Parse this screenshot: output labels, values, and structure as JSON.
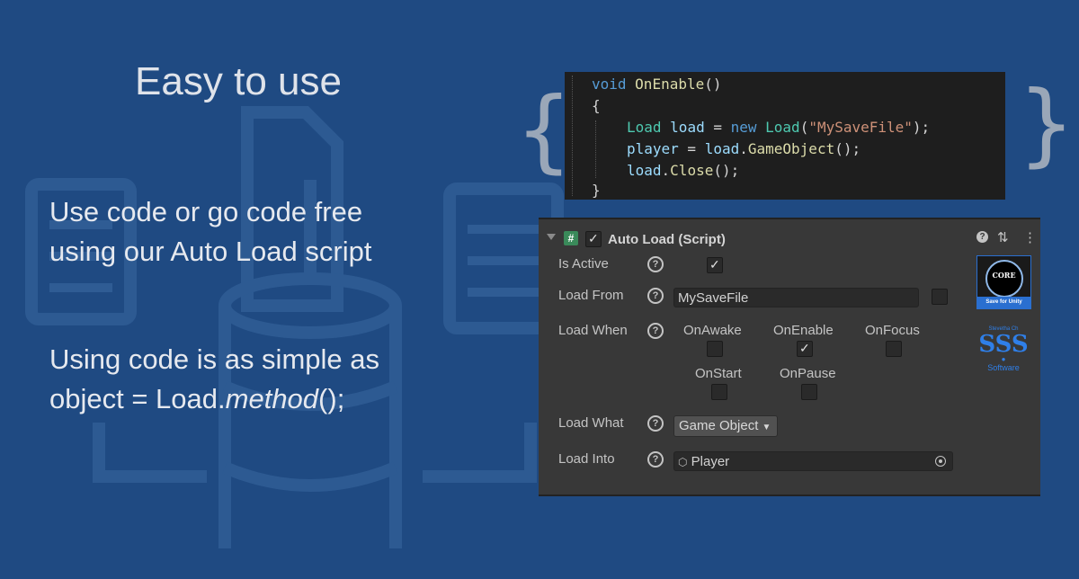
{
  "slide": {
    "title": "Easy to use",
    "paragraph1": {
      "line1": "Use code or go code free",
      "line2": "using our Auto Load script"
    },
    "paragraph2": {
      "line1": "Using code is as simple as",
      "line2_prefix": "object = Load.",
      "line2_method": "method",
      "line2_suffix": "();"
    }
  },
  "braces": {
    "open": "{",
    "close": "}"
  },
  "code": {
    "line1": {
      "kw": "void",
      "name": "OnEnable",
      "rest": "()"
    },
    "line2": "{",
    "line3": {
      "type": "Load",
      "var": "load",
      "eq": " = ",
      "kw": "new",
      "ctor": "Load",
      "open": "(",
      "str": "\"MySaveFile\"",
      "close": ");"
    },
    "line4": {
      "var": "player",
      "eq": " = ",
      "obj": "load",
      "dot": ".",
      "method": "GameObject",
      "rest": "();"
    },
    "line5": {
      "obj": "load",
      "dot": ".",
      "method": "Close",
      "rest": "();"
    },
    "line6": "}"
  },
  "inspector": {
    "header": {
      "title": "Auto Load (Script)",
      "enabled": true
    },
    "rows": {
      "is_active": {
        "label": "Is Active",
        "checked": true
      },
      "load_from": {
        "label": "Load From",
        "value": "MySaveFile"
      },
      "load_when": {
        "label": "Load When",
        "options": [
          {
            "label": "OnAwake",
            "checked": false
          },
          {
            "label": "OnEnable",
            "checked": true
          },
          {
            "label": "OnFocus",
            "checked": false
          },
          {
            "label": "OnStart",
            "checked": false
          },
          {
            "label": "OnPause",
            "checked": false
          }
        ]
      },
      "load_what": {
        "label": "Load What",
        "value": "Game Object"
      },
      "load_into": {
        "label": "Load Into",
        "value": "Player"
      }
    },
    "help_glyph": "?",
    "logo": {
      "core_text": "CORE",
      "caption": "Save for Unity"
    },
    "sss_logo": {
      "top": "Stevetha Ch",
      "main": "SSS",
      "bottom": "Software"
    }
  },
  "colors": {
    "background": "#1f4a82",
    "code_bg": "#1e1e1e",
    "inspector_bg": "#383838"
  }
}
